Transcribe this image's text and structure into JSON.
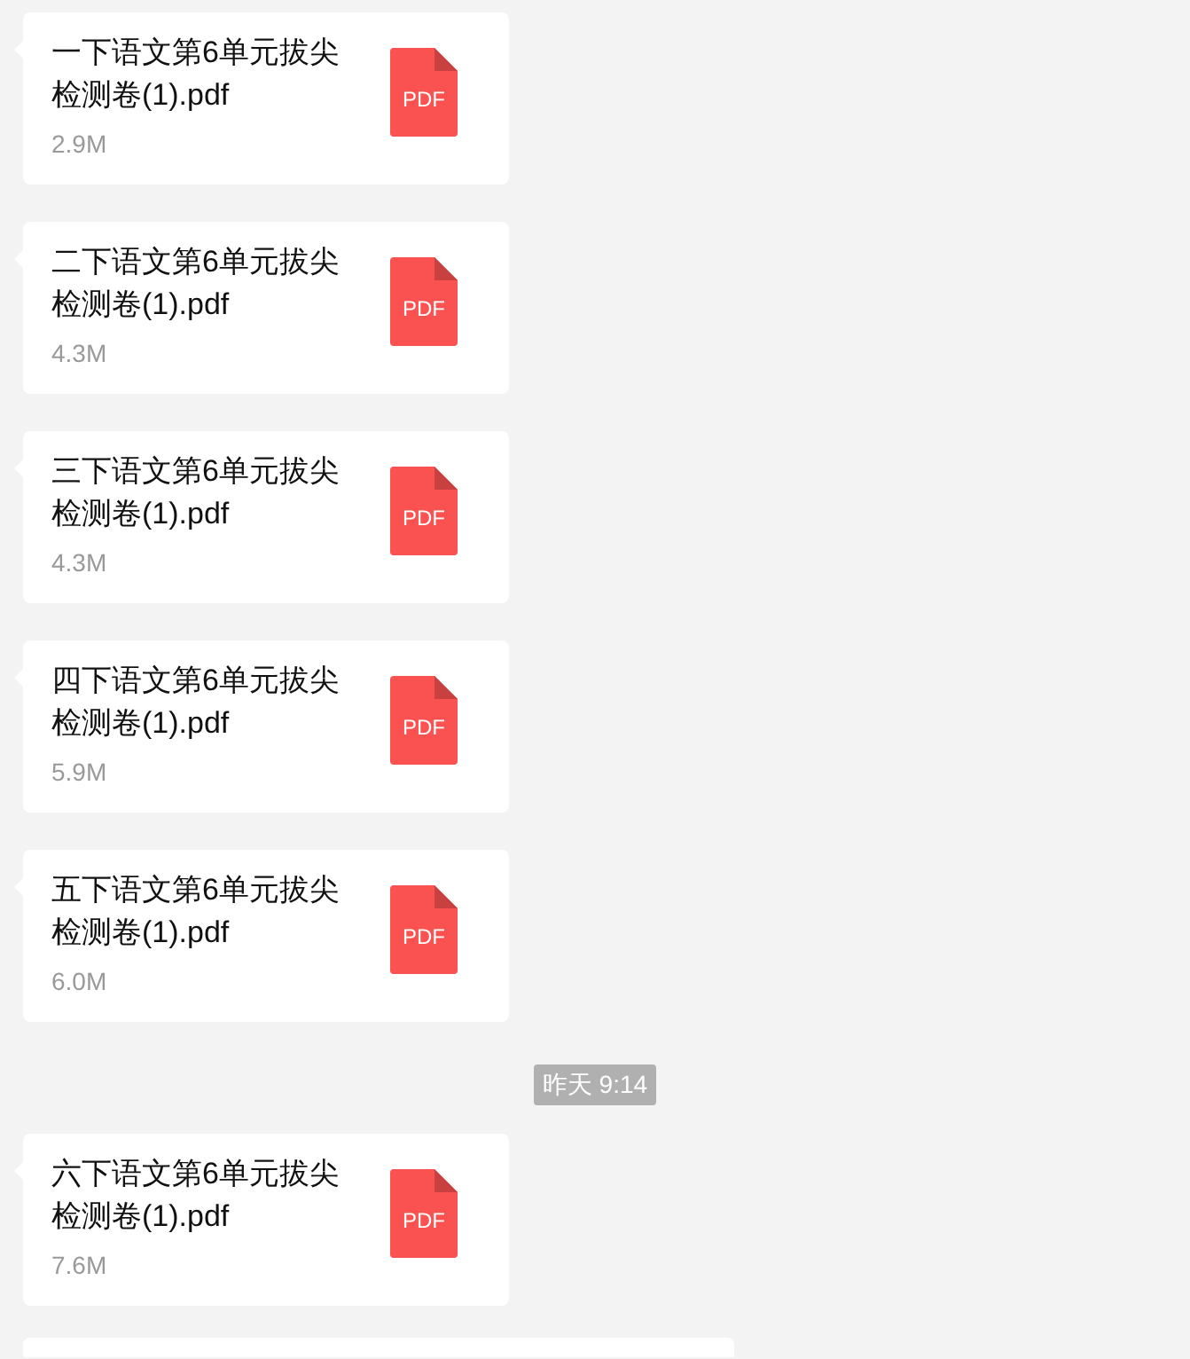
{
  "messages": [
    {
      "kind": "file",
      "name": "一下语文第6单元拔尖检测卷(1).pdf",
      "size": "2.9M",
      "icon_label": "PDF"
    },
    {
      "kind": "file",
      "name": "二下语文第6单元拔尖检测卷(1).pdf",
      "size": "4.3M",
      "icon_label": "PDF"
    },
    {
      "kind": "file",
      "name": "三下语文第6单元拔尖检测卷(1).pdf",
      "size": "4.3M",
      "icon_label": "PDF"
    },
    {
      "kind": "file",
      "name": "四下语文第6单元拔尖检测卷(1).pdf",
      "size": "5.9M",
      "icon_label": "PDF"
    },
    {
      "kind": "file",
      "name": "五下语文第6单元拔尖检测卷(1).pdf",
      "size": "6.0M",
      "icon_label": "PDF"
    },
    {
      "kind": "time",
      "text": "昨天 9:14"
    },
    {
      "kind": "file",
      "name": "六下语文第6单元拔尖检测卷(1).pdf",
      "size": "7.6M",
      "icon_label": "PDF"
    },
    {
      "kind": "bubble"
    }
  ]
}
